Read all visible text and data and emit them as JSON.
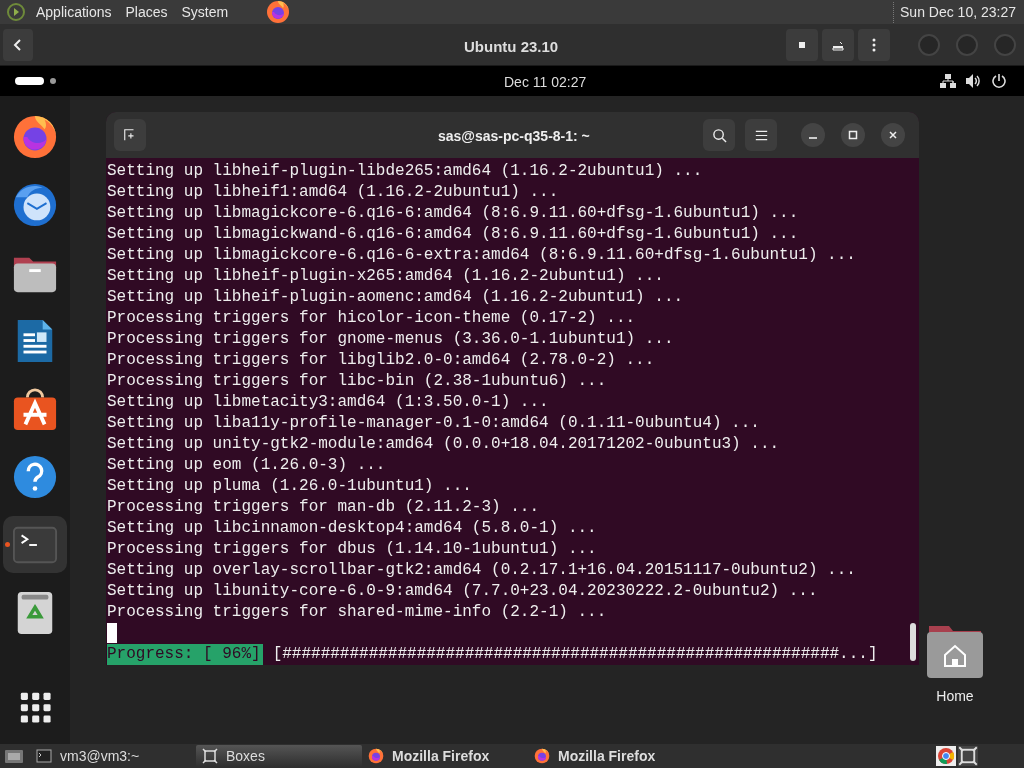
{
  "top_panel": {
    "menus": [
      "Applications",
      "Places",
      "System"
    ],
    "clock": "Sun Dec 10, 23:27"
  },
  "boxes_header": {
    "title": "Ubuntu 23.10"
  },
  "gnome_bar": {
    "clock": "Dec 11  02:27"
  },
  "dock": [
    {
      "kind": "firefox",
      "running": false
    },
    {
      "kind": "mail",
      "running": false
    },
    {
      "kind": "files",
      "running": false
    },
    {
      "kind": "writer",
      "running": false
    },
    {
      "kind": "store",
      "running": false
    },
    {
      "kind": "help",
      "running": false
    },
    {
      "kind": "terminal",
      "running": true
    },
    {
      "kind": "trash",
      "running": false
    },
    {
      "kind": "apps",
      "running": false
    }
  ],
  "terminal": {
    "title": "sas@sas-pc-q35-8-1: ~",
    "lines": [
      "Setting up libheif-plugin-libde265:amd64 (1.16.2-2ubuntu1) ...",
      "Setting up libheif1:amd64 (1.16.2-2ubuntu1) ...",
      "Setting up libmagickcore-6.q16-6:amd64 (8:6.9.11.60+dfsg-1.6ubuntu1) ...",
      "Setting up libmagickwand-6.q16-6:amd64 (8:6.9.11.60+dfsg-1.6ubuntu1) ...",
      "Setting up libmagickcore-6.q16-6-extra:amd64 (8:6.9.11.60+dfsg-1.6ubuntu1) ...",
      "Setting up libheif-plugin-x265:amd64 (1.16.2-2ubuntu1) ...",
      "Setting up libheif-plugin-aomenc:amd64 (1.16.2-2ubuntu1) ...",
      "Processing triggers for hicolor-icon-theme (0.17-2) ...",
      "Processing triggers for gnome-menus (3.36.0-1.1ubuntu1) ...",
      "Processing triggers for libglib2.0-0:amd64 (2.78.0-2) ...",
      "Processing triggers for libc-bin (2.38-1ubuntu6) ...",
      "Setting up libmetacity3:amd64 (1:3.50.0-1) ...",
      "Setting up liba11y-profile-manager-0.1-0:amd64 (0.1.11-0ubuntu4) ...",
      "Setting up unity-gtk2-module:amd64 (0.0.0+18.04.20171202-0ubuntu3) ...",
      "Setting up eom (1.26.0-3) ...",
      "Setting up pluma (1.26.0-1ubuntu1) ...",
      "Processing triggers for man-db (2.11.2-3) ...",
      "Setting up libcinnamon-desktop4:amd64 (5.8.0-1) ...",
      "Processing triggers for dbus (1.14.10-1ubuntu1) ...",
      "Setting up overlay-scrollbar-gtk2:amd64 (0.2.17.1+16.04.20151117-0ubuntu2) ...",
      "Setting up libunity-core-6.0-9:amd64 (7.7.0+23.04.20230222.2-0ubuntu2) ...",
      "Processing triggers for shared-mime-info (2.2-1) ..."
    ],
    "progress_label": "Progress: [ 96%]",
    "progress_bar": "[##########################################################...]"
  },
  "desktop_icons": [
    {
      "label": "Home"
    }
  ],
  "taskbar": [
    {
      "label": "vm3@vm3:~",
      "kind": "terminal",
      "selected": false
    },
    {
      "label": "Boxes",
      "kind": "boxes",
      "selected": true
    },
    {
      "label": "Mozilla Firefox",
      "kind": "firefox",
      "selected": false
    },
    {
      "label": "Mozilla Firefox",
      "kind": "firefox",
      "selected": false
    }
  ]
}
